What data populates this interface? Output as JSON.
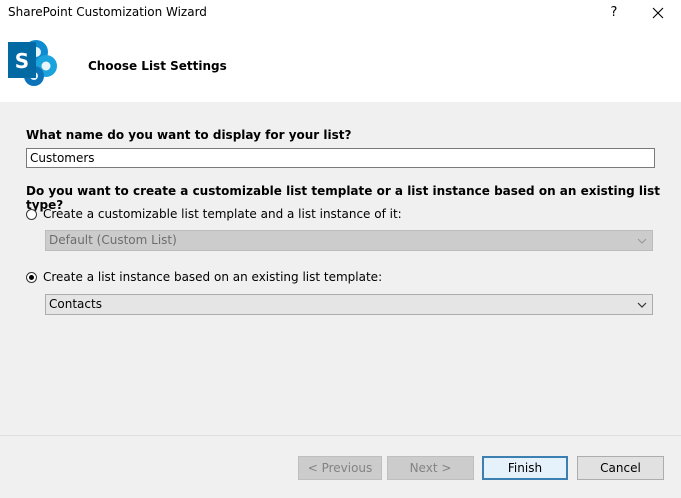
{
  "window": {
    "title": "SharePoint Customization Wizard",
    "help_label": "?",
    "close_icon": "close-icon"
  },
  "header": {
    "logo_icon": "sharepoint-logo-icon",
    "logo_letter": "S",
    "page_title": "Choose List Settings",
    "brand_color": "#0369a3"
  },
  "form": {
    "name_question": "What name do you want to display for your list?",
    "name_value": "Customers",
    "type_question": "Do you want to create a customizable list template or a list instance based on an existing list type?",
    "option_template": {
      "label": "Create a customizable list template and a list instance of it:",
      "checked": false,
      "select_value": "Default (Custom List)",
      "select_enabled": false
    },
    "option_instance": {
      "label": "Create a list instance based on an existing list template:",
      "checked": true,
      "select_value": "Contacts",
      "select_enabled": true
    }
  },
  "footer": {
    "previous_label": "< Previous",
    "next_label": "Next >",
    "finish_label": "Finish",
    "cancel_label": "Cancel"
  }
}
